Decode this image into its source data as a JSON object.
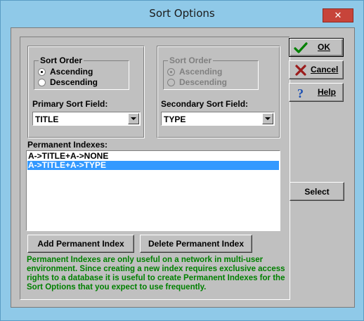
{
  "window": {
    "title": "Sort Options",
    "close_glyph": "✕",
    "frame_color": "#8fc9e8",
    "client_color": "#c0c0c0"
  },
  "sort_order_primary": {
    "title": "Sort Order",
    "options": [
      {
        "label": "Ascending",
        "selected": true
      },
      {
        "label": "Descending",
        "selected": false
      }
    ]
  },
  "sort_order_secondary": {
    "title": "Sort Order",
    "enabled": false,
    "options": [
      {
        "label": "Ascending",
        "selected": true
      },
      {
        "label": "Descending",
        "selected": false
      }
    ]
  },
  "primary_field": {
    "label": "Primary Sort Field:",
    "value": "TITLE"
  },
  "secondary_field": {
    "label": "Secondary Sort Field:",
    "value": "TYPE"
  },
  "indexes": {
    "label": "Permanent Indexes:",
    "items": [
      {
        "text": "A->TITLE+A->NONE",
        "selected": false
      },
      {
        "text": "A->TITLE+A->TYPE",
        "selected": true
      }
    ],
    "selection_color": "#3399ff"
  },
  "buttons": {
    "add_index": "Add Permanent Index",
    "delete_index": "Delete Permanent Index",
    "ok": "OK",
    "cancel": "Cancel",
    "help": "Help",
    "select": "Select"
  },
  "icons": {
    "ok": "check-icon",
    "cancel": "x-icon",
    "help": "question-icon"
  },
  "note": {
    "text": "Permanent Indexes are only useful on a network in multi-user environment. Since creating a new index requires exclusive access rights to a database it is useful to create Permanent Indexes for the Sort Options that you expect to use frequently.",
    "color": "#008000"
  }
}
